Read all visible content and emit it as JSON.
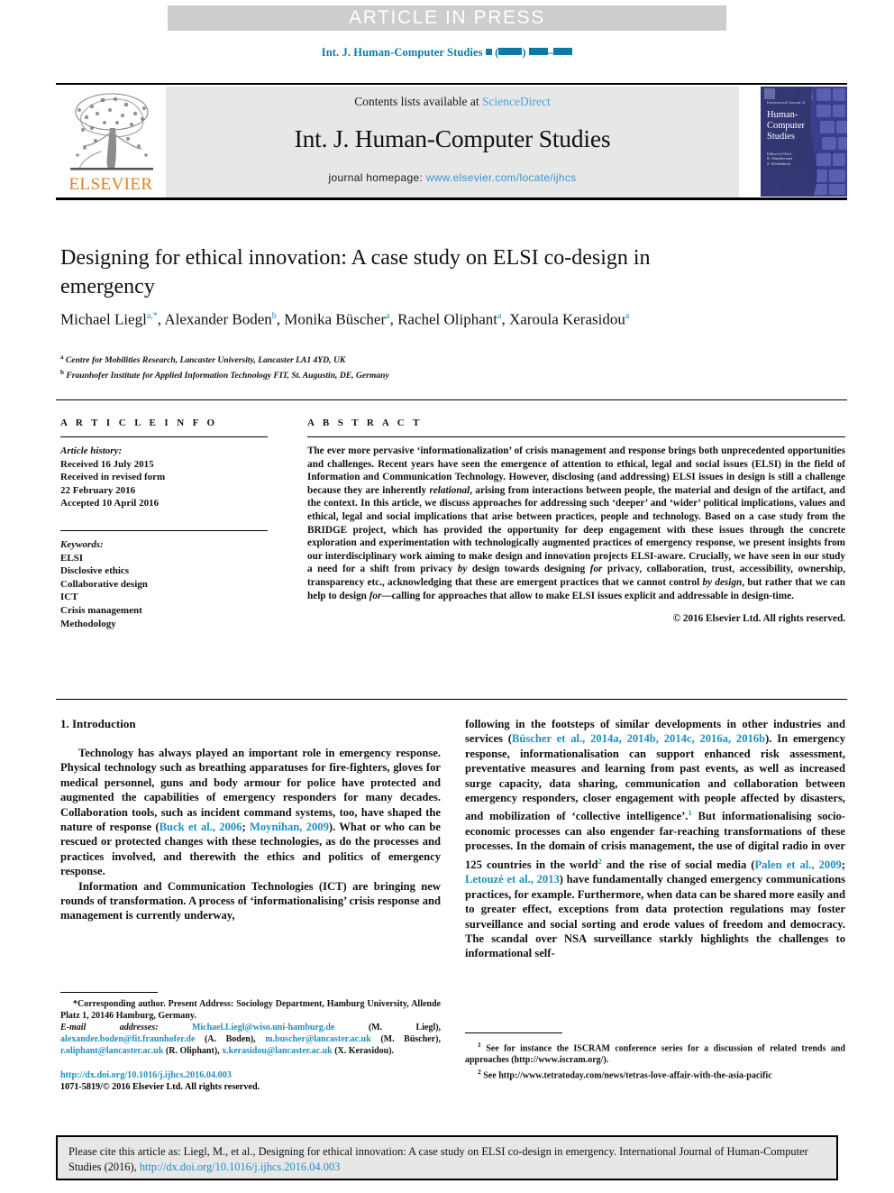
{
  "banner": {
    "label": "ARTICLE IN PRESS"
  },
  "running_head": {
    "journal": "Int. J. Human-Computer Studies",
    "redaction_note": "▪ (▪▪▪▪) ▪▪▪–▪▪▪"
  },
  "masthead": {
    "contents_prefix": "Contents lists available at ",
    "sciencedirect": "ScienceDirect",
    "journal_title": "Int. J. Human-Computer Studies",
    "homepage_prefix": "journal homepage: ",
    "homepage_url": "www.elsevier.com/locate/ijhcs",
    "publisher_wordmark": "ELSEVIER",
    "cover": {
      "superline": "International Journal of",
      "title_line1": "Human-",
      "title_line2": "Computer",
      "title_line3": "Studies",
      "editors": "Editor-in-Chief\nB. Shneiderman\nS. Wiedenbeck"
    },
    "accent_link_color": "#4ea3d8",
    "elsevier_orange": "#e87d1e"
  },
  "article": {
    "title": "Designing for ethical innovation: A case study on ELSI co-design in emergency",
    "authors": [
      {
        "name": "Michael Liegl",
        "marks": "a,*"
      },
      {
        "name": "Alexander Boden",
        "marks": "b"
      },
      {
        "name": "Monika Büscher",
        "marks": "a"
      },
      {
        "name": "Rachel Oliphant",
        "marks": "a"
      },
      {
        "name": "Xaroula Kerasidou",
        "marks": "a"
      }
    ],
    "affiliations": [
      {
        "mark": "a",
        "text": "Centre for Mobilities Research, Lancaster University, Lancaster LA1 4YD, UK"
      },
      {
        "mark": "b",
        "text": "Fraunhofer Institute for Applied Information Technology FIT, St. Augustin, DE, Germany"
      }
    ]
  },
  "info": {
    "heading": "A R T I C L E  I N F O",
    "history_label": "Article history:",
    "history": [
      "Received 16 July 2015",
      "Received in revised form",
      "22 February 2016",
      "Accepted 10 April 2016"
    ],
    "keywords_label": "Keywords:",
    "keywords": [
      "ELSI",
      "Disclosive ethics",
      "Collaborative design",
      "ICT",
      "Crisis management",
      "Methodology"
    ]
  },
  "abstract": {
    "heading": "A B S T R A C T",
    "paragraph_part1": "The ever more pervasive ‘informationalization’ of crisis management and response brings both unprecedented opportunities and challenges. Recent years have seen the emergence of attention to ethical, legal and social issues (ELSI) in the field of Information and Communication Technology. However, disclosing (and addressing) ELSI issues in design is still a challenge because they are inherently ",
    "italic1": "relational",
    "paragraph_part2": ", arising from interactions between people, the material and design of the artifact, and the context. In this article, we discuss approaches for addressing such ‘deeper’ and ‘wider’ political implications, values and ethical, legal and social implications that arise between practices, people and technology. Based on a case study from the BRIDGE project, which has provided the opportunity for deep engagement with these issues through the concrete exploration and experimentation with technologically augmented practices of emergency response, we present insights from our interdisciplinary work aiming to make design and innovation projects ELSI-aware. Crucially, we have seen in our study a need for a shift from privacy ",
    "italic2": "by",
    "paragraph_part3": " design towards designing ",
    "italic3": "for",
    "paragraph_part4": " privacy, collaboration, trust, accessibility, ownership, transparency etc., acknowledging that these are emergent practices that we cannot control ",
    "italic4": "by design",
    "paragraph_part5": ", but rather that we can help to design ",
    "italic5": "for",
    "paragraph_part6": "—calling for approaches that allow to make ELSI issues explicit and addressable in design-time.",
    "copyright": "© 2016 Elsevier Ltd. All rights reserved."
  },
  "body": {
    "section_heading": "1. Introduction",
    "left_para1_a": "Technology has always played an important role in emergency response. Physical technology such as breathing apparatuses for fire-fighters, gloves for medical personnel, guns and body armour for police have protected and augmented the capabilities of emergency responders for many decades. Collaboration tools, such as incident command systems, too, have shaped the nature of response (",
    "left_cite1": "Buck et al., 2006",
    "left_para1_b": "; ",
    "left_cite2": "Moynihan, 2009",
    "left_para1_c": "). What or who can be rescued or protected changes with these technologies, as do the processes and practices involved, and therewith the ethics and politics of emergency response.",
    "left_para2": "Information and Communication Technologies (ICT) are bringing new rounds of transformation. A process of ‘informationalising’ crisis response and management is currently underway,",
    "right_para1_a": "following in the footsteps of similar developments in other industries and services (",
    "right_cite1": "Büscher et al., 2014a",
    "right_cite1_b": ", 2014b",
    "right_cite1_c": ", 2014c",
    "right_cite1_d": ", 2016a",
    "right_cite1_e": ", 2016b",
    "right_para1_b": "). In emergency response, informationalisation can support enhanced risk assessment, preventative measures and learning from past events, as well as increased surge capacity, data sharing, communication and collaboration between emergency responders, closer engagement with people affected by disasters, and mobilization of ‘collective intelligence’.",
    "right_fn1": "1",
    "right_para1_c": " But informationalising socio-economic processes can also engender far-reaching transformations of these processes. In the domain of crisis management, the use of digital radio in over 125 countries in the world",
    "right_fn2": "2",
    "right_para1_d": " and the rise of social media (",
    "right_cite2": "Palen et al., 2009",
    "right_para1_e": "; ",
    "right_cite3": "Letouzé et al., 2013",
    "right_para1_f": ") have fundamentally changed emergency communications practices, for example. Furthermore, when data can be shared more easily and to greater effect, exceptions from data protection regulations may foster surveillance and social sorting and erode values of freedom and democracy. The scandal over NSA surveillance starkly highlights the challenges to informational self-"
  },
  "footnotes": {
    "left": {
      "corresponding": "*Corresponding author. Present Address: Sociology Department, Hamburg University, Allende Platz 1, 20146 Hamburg, Germany.",
      "email_label": "E-mail addresses:",
      "emails": [
        {
          "address": "Michael.Liegl@wiso.uni-hamburg.de",
          "owner": " (M. Liegl), "
        },
        {
          "address": "alexander.boden@fit.fraunhofer.de",
          "owner": " (A. Boden), "
        },
        {
          "address": "m.buscher@lancaster.ac.uk",
          "owner": " (M. Büscher), "
        },
        {
          "address": "r.oliphant@lancaster.ac.uk",
          "owner": " (R. Oliphant), "
        },
        {
          "address": "x.kerasidou@lancaster.ac.uk",
          "owner": " (X. Kerasidou)."
        }
      ],
      "doi": "http://dx.doi.org/10.1016/j.ijhcs.2016.04.003",
      "issn_line": "1071-5819/© 2016 Elsevier Ltd. All rights reserved."
    },
    "right": {
      "note1_num": "1",
      "note1": " See for instance the ISCRAM conference series for a discussion of related trends and approaches (http://www.iscram.org/).",
      "note2_num": "2",
      "note2": " See http://www.tetratoday.com/news/tetras-love-affair-with-the-asia-pacific"
    }
  },
  "citation_box": {
    "text_before_link": "Please cite this article as: Liegl, M., et al., Designing for ethical innovation: A case study on ELSI co-design in emergency. International Journal of Human-Computer Studies (2016), ",
    "link": "http://dx.doi.org/10.1016/j.ijhcs.2016.04.003"
  }
}
